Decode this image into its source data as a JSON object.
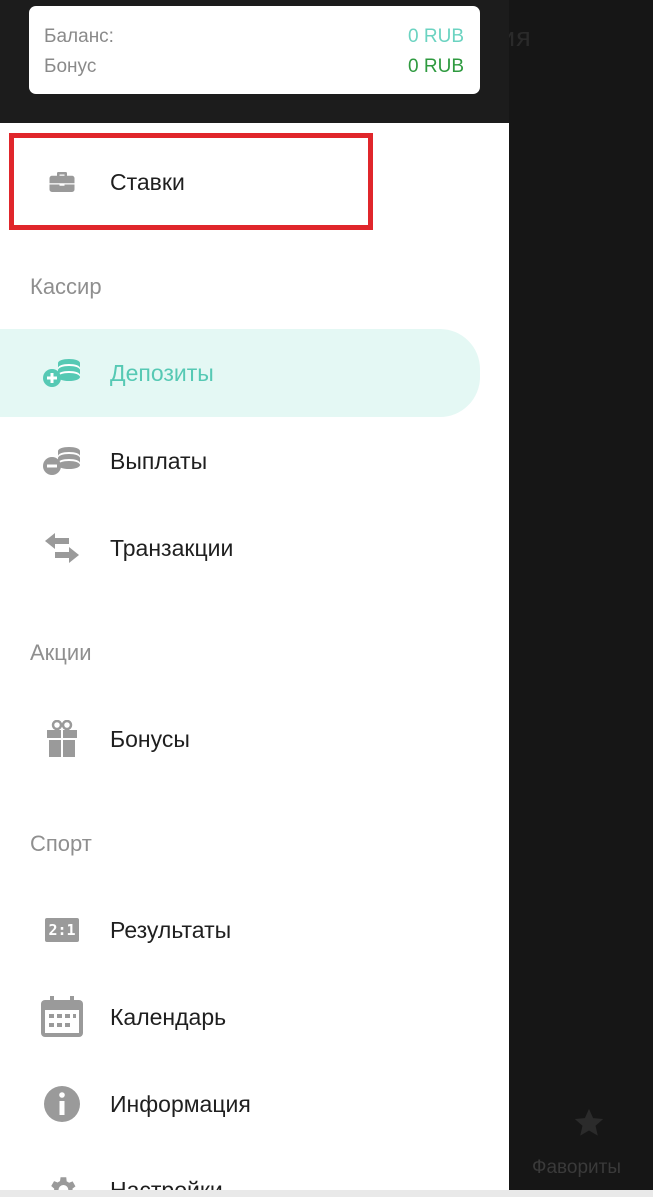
{
  "backdrop": {
    "title_fragment": "ия",
    "favorites_label": "Фавориты",
    "favorites_icon": "star-icon"
  },
  "balance_card": {
    "balance_label": "Баланс:",
    "balance_value": "0 RUB",
    "bonus_label": "Бонус",
    "bonus_value": "0 RUB"
  },
  "menu": {
    "bets": {
      "label": "Ставки",
      "icon": "briefcase-icon"
    },
    "cashier_header": "Кассир",
    "deposits": {
      "label": "Депозиты",
      "icon": "coins-plus-icon"
    },
    "payouts": {
      "label": "Выплаты",
      "icon": "coins-minus-icon"
    },
    "transactions": {
      "label": "Транзакции",
      "icon": "swap-arrows-icon"
    },
    "promo_header": "Акции",
    "bonuses": {
      "label": "Бонусы",
      "icon": "gift-icon"
    },
    "sport_header": "Спорт",
    "results": {
      "label": "Результаты",
      "icon": "score-icon"
    },
    "calendar": {
      "label": "Календарь",
      "icon": "calendar-icon"
    },
    "info": {
      "label": "Информация",
      "icon": "info-icon"
    },
    "settings": {
      "label": "Настройки",
      "icon": "gear-icon"
    }
  },
  "colors": {
    "accent": "#56c9b4",
    "active_bg": "#e4f8f4",
    "bonus_value": "#2e9a3f",
    "highlight": "#e0262b",
    "icon_gray": "#9a9a9a"
  },
  "score_icon_text": "2:1"
}
